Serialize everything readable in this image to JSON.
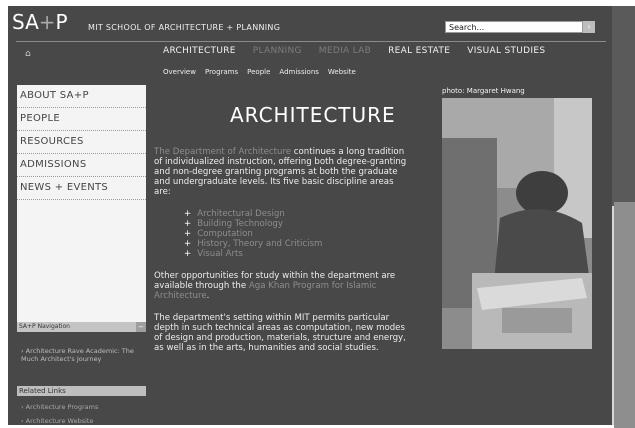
{
  "header": {
    "logo_main": "SA",
    "logo_plus": "+",
    "logo_end": "P",
    "school": "MIT SCHOOL OF ARCHITECTURE + PLANNING",
    "search_placeholder": "Search..."
  },
  "main_nav": [
    "ARCHITECTURE",
    "PLANNING",
    "MEDIA LAB",
    "REAL ESTATE",
    "VISUAL STUDIES"
  ],
  "sub_nav": [
    "Overview",
    "Programs",
    "People",
    "Admissions",
    "Website"
  ],
  "left_nav": {
    "items": [
      "ABOUT SA+P",
      "PEOPLE",
      "RESOURCES",
      "ADMISSIONS",
      "NEWS + EVENTS"
    ],
    "sap_navigation_label": "SA+P Navigation",
    "sap_link": "Architecture Rave Academic: The Much Architect's Journey",
    "related_links_label": "Related Links",
    "related_1": "Architecture Programs",
    "related_2": "Architecture Website"
  },
  "content": {
    "title": "ARCHITECTURE",
    "intro_link": "The Department of Architecture",
    "intro_rest": " continues a long tradition of individualized instruction, offering both degree-granting and non-degree granting programs at both the graduate and undergraduate levels. Its five basic discipline areas are:",
    "areas": [
      "Architectural Design",
      "Building Technology",
      "Computation",
      "History, Theory and Criticism",
      "Visual Arts"
    ],
    "para2_start": "Other opportunities for study within the department are available through the ",
    "para2_link": "Aga Khan Program for Islamic Architecture",
    "para2_end": ".",
    "para3": "The department's setting within MIT permits particular depth in such technical areas as computation, new modes of design and production, materials, structure and energy, as well as in the arts, humanities and social studies."
  },
  "photo": {
    "caption": "photo: Margaret Hwang"
  }
}
